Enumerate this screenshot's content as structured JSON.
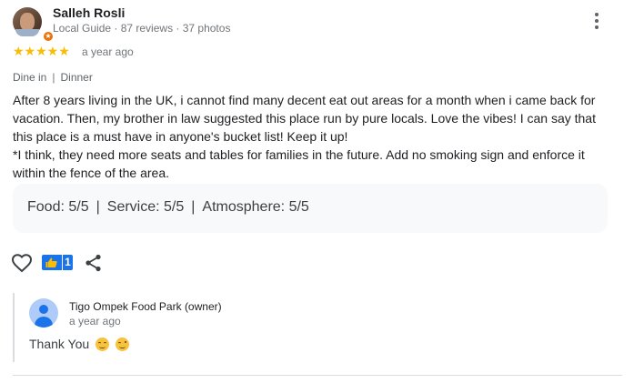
{
  "review": {
    "reviewer_name": "Salleh Rosli",
    "reviewer_meta": "Local Guide · 87 reviews · 37 photos",
    "stars": "★★★★★",
    "rating_value": 5,
    "rating_max": 5,
    "time": "a year ago",
    "tags": [
      "Dine in",
      "Dinner"
    ],
    "text": "After 8 years living in the UK, i cannot find many decent eat out areas for a month when i came back for vacation. Then, my brother in law suggested this place run by pure locals. Love the vibes! I can say that this place is a must have in anyone's bucket list! Keep it up!\n*I think, they need more seats and tables for families in the future. Add no smoking sign and enforce it within the fence of the area.",
    "ratings": [
      {
        "label": "Food: 5/5"
      },
      {
        "label": "Service: 5/5"
      },
      {
        "label": "Atmosphere: 5/5"
      }
    ],
    "ratings_separator": "|",
    "like_count": "1"
  },
  "owner_reply": {
    "name": "Tigo Ompek Food Park (owner)",
    "time": "a year ago",
    "text": "Thank You"
  },
  "icons": {
    "like": "heart-outline-icon",
    "reaction": "thumbs-up-badge-icon",
    "share": "share-icon",
    "more": "more-vert-icon"
  },
  "colors": {
    "star": "#fbbc04",
    "accent": "#1a73e8",
    "guide_badge": "#e8710a"
  }
}
